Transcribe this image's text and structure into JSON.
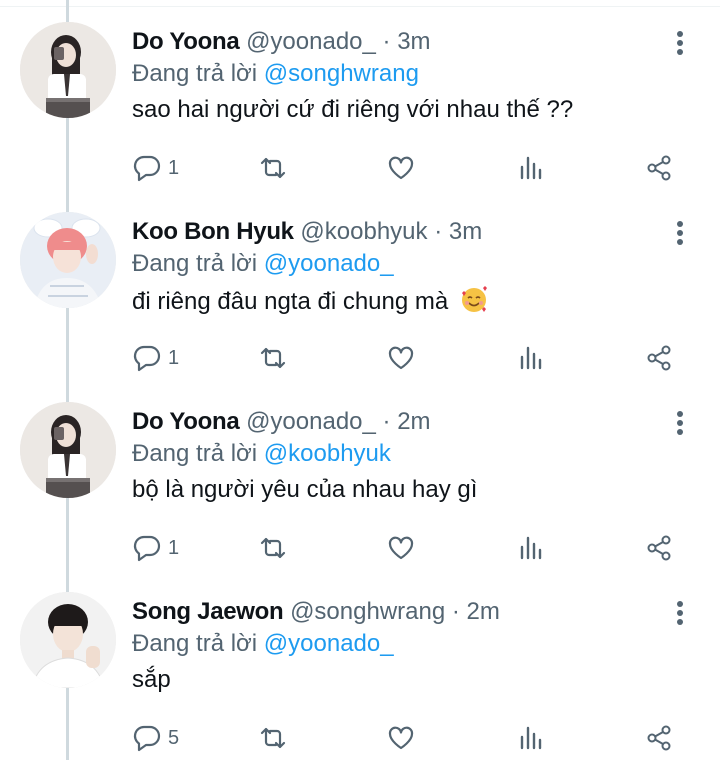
{
  "tweets": [
    {
      "name": "Do Yoona",
      "handle": "@yoonado_",
      "time": "3m",
      "reply_prefix": "Đang trả lời",
      "reply_to": "@songhwrang",
      "text": "sao hai người cứ đi riêng với nhau thế ??",
      "reply_count": "1",
      "avatar": "girl-mirror-selfie"
    },
    {
      "name": "Koo Bon Hyuk",
      "handle": "@koobhyuk",
      "time": "3m",
      "reply_prefix": "Đang trả lời",
      "reply_to": "@yoonado_",
      "text": "đi riêng đâu ngta đi chung mà",
      "emoji": "smiling-face-with-hearts",
      "reply_count": "1",
      "avatar": "boy-pink-hair-bunny-ears"
    },
    {
      "name": "Do Yoona",
      "handle": "@yoonado_",
      "time": "2m",
      "reply_prefix": "Đang trả lời",
      "reply_to": "@koobhyuk",
      "text": "bộ là người yêu của nhau hay gì",
      "reply_count": "1",
      "avatar": "girl-mirror-selfie"
    },
    {
      "name": "Song Jaewon",
      "handle": "@songhwrang",
      "time": "2m",
      "reply_prefix": "Đang trả lời",
      "reply_to": "@yoonado_",
      "text": "sắp",
      "reply_count": "5",
      "avatar": "boy-dark-hair-portrait"
    }
  ],
  "separator": "·",
  "colors": {
    "mention": "#1d9bf0",
    "secondary_text": "#536471",
    "thread_line": "#cfd9de"
  }
}
